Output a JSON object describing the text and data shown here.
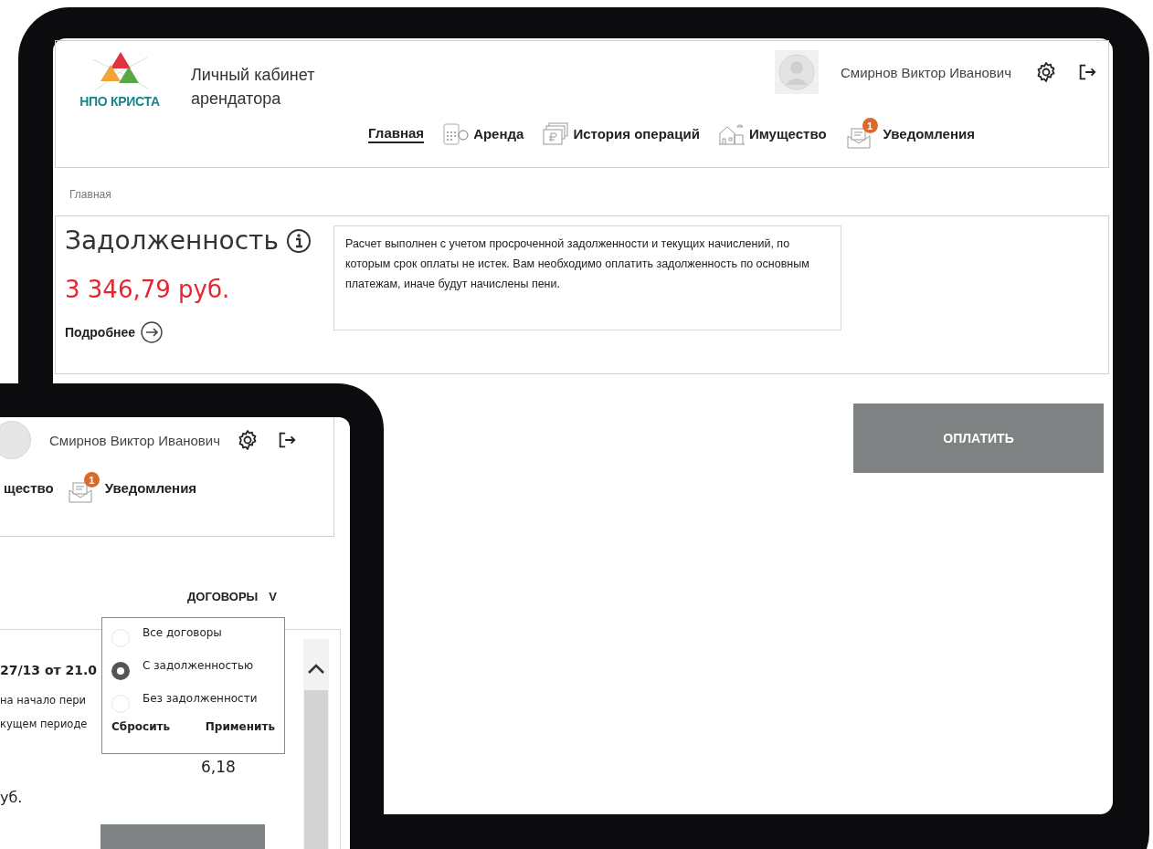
{
  "main_screen": {
    "logo": {
      "text": "НПО КРИСТА"
    },
    "title": "Личный кабинет арендатора",
    "user": {
      "name": "Смирнов Виктор Иванович"
    },
    "nav": [
      {
        "kind": "home",
        "label": "Главная",
        "selected": true
      },
      {
        "kind": "rent",
        "label": "Аренда",
        "selected": false
      },
      {
        "kind": "history",
        "label": "История операций",
        "selected": false
      },
      {
        "kind": "property",
        "label": "Имущество",
        "selected": false
      },
      {
        "kind": "notifications",
        "label": "Уведомления",
        "selected": false,
        "badge": "1"
      }
    ],
    "breadcrumb": "Главная",
    "debt": {
      "title": "Задолженность",
      "amount": "3 346,79 руб.",
      "more_link": "Подробнее"
    },
    "info_text": "Расчет выполнен с учетом  просроченной задолженности и текущих начислений, по которым срок оплаты не истек.  Вам необходимо оплатить задолженность по основным платежам, иначе будут начислены пени.",
    "pay_button": "ОПЛАТИТЬ"
  },
  "second_screen": {
    "user": {
      "name": "Смирнов Виктор Иванович"
    },
    "nav": [
      {
        "kind": "property",
        "label": "щество"
      },
      {
        "kind": "notifications",
        "label": "Уведомления",
        "badge": "1"
      }
    ],
    "filter": {
      "label": "ДОГОВОРЫ",
      "caret": "V"
    },
    "filter_options": [
      {
        "label": "Все договоры",
        "selected": false
      },
      {
        "label": "С задолженностью",
        "selected": true
      },
      {
        "label": "Без задолженности",
        "selected": false
      }
    ],
    "filter_actions": [
      "Сбросить",
      "Применить"
    ],
    "contract": {
      "title": "27/13 от 21.0",
      "rows": [
        "на начало пери",
        "кущем периоде"
      ],
      "value": "6,18",
      "amount": "уб."
    }
  }
}
